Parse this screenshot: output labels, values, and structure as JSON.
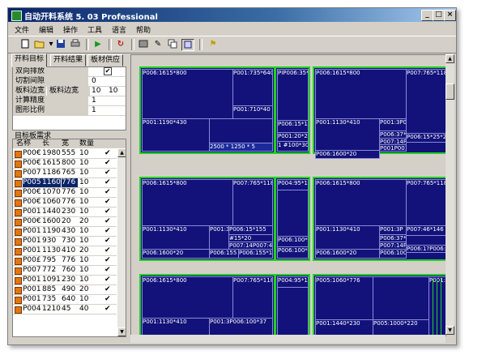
{
  "window": {
    "title": "自动开料系统 5. 03 Professional"
  },
  "titlebar_buttons": [
    "_",
    "□",
    "×"
  ],
  "menu": [
    "文件",
    "编辑",
    "操作",
    "工具",
    "语言",
    "帮助"
  ],
  "toolbar_icons": [
    "new-icon",
    "open-icon",
    "save-icon",
    "print-icon",
    "run-icon",
    "refresh-icon",
    "image-icon",
    "edit-icon",
    "copy-icon",
    "layout-icon",
    "help-icon"
  ],
  "tabs": [
    "开料目标",
    "开料结果",
    "板材供应"
  ],
  "props": [
    {
      "label": "双向排放",
      "value": "✔"
    },
    {
      "label": "切割间隙",
      "value": "0"
    },
    {
      "label": "板料边宽",
      "label2": "板料边宽",
      "value": "10",
      "value2": "10"
    },
    {
      "label": "计算精度",
      "value": "1"
    },
    {
      "label": "图形比例",
      "value": "1"
    }
  ],
  "list_title": "目标板需求",
  "columns": [
    "名称",
    "长",
    "宽",
    "数量"
  ],
  "rows": [
    {
      "name": "P00€",
      "len": "1980",
      "wid": "555",
      "qty": "10",
      "chk": "✔"
    },
    {
      "name": "P00€",
      "len": "1615",
      "wid": "800",
      "qty": "10",
      "chk": "✔"
    },
    {
      "name": "P007",
      "len": "1186",
      "wid": "765",
      "qty": "10",
      "chk": "✔"
    },
    {
      "name": "P005",
      "len": "1160",
      "wid": "776",
      "qty": "10",
      "chk": "✔",
      "selected": true
    },
    {
      "name": "P00€",
      "len": "1070",
      "wid": "776",
      "qty": "10",
      "chk": "✔"
    },
    {
      "name": "P00€",
      "len": "1060",
      "wid": "776",
      "qty": "10",
      "chk": "✔"
    },
    {
      "name": "P001",
      "len": "1440",
      "wid": "230",
      "qty": "10",
      "chk": "✔"
    },
    {
      "name": "P00€",
      "len": "1600",
      "wid": "20",
      "qty": "20",
      "chk": "✔"
    },
    {
      "name": "P001",
      "len": "1190",
      "wid": "430",
      "qty": "10",
      "chk": "✔"
    },
    {
      "name": "P001",
      "len": "930",
      "wid": "730",
      "qty": "10",
      "chk": "✔"
    },
    {
      "name": "P001",
      "len": "1130",
      "wid": "410",
      "qty": "20",
      "chk": "✔"
    },
    {
      "name": "P00£",
      "len": "795",
      "wid": "776",
      "qty": "10",
      "chk": "✔"
    },
    {
      "name": "P007",
      "len": "772",
      "wid": "760",
      "qty": "10",
      "chk": "✔"
    },
    {
      "name": "P001",
      "len": "1091",
      "wid": "230",
      "qty": "10",
      "chk": "✔"
    },
    {
      "name": "P001",
      "len": "885",
      "wid": "490",
      "qty": "20",
      "chk": "✔"
    },
    {
      "name": "P001",
      "len": "735",
      "wid": "640",
      "qty": "10",
      "chk": "✔"
    },
    {
      "name": "P004",
      "len": "1210",
      "wid": "45",
      "qty": "40",
      "chk": "✔"
    }
  ],
  "canvas": {
    "labels": {
      "a1": "P006:1615*800",
      "a2": "P001:735*640",
      "a3": "P001:710*40",
      "a4": "P001:1190*430",
      "a5": "PIP006:35*1",
      "a6": "P006:15*155",
      "a7": "P001:20*2",
      "a8": "2500 * 1250 * 5",
      "a9": "1 #100*30",
      "b1": "P006:1615*800",
      "b2": "P007:765*1186",
      "b3": "P001:1130*410",
      "b4": "P001:3P001:20*250",
      "b5": "P006:37*100",
      "b6": "P007:14P007:46*146",
      "b7": "P006:1600*20",
      "b8": "P001P001",
      "b9": "P006:15*25*25",
      "c1": "P006:1615*800",
      "c2": "P007:765*1186",
      "c3": "P001:1130*410",
      "c4": "P001:3P",
      "c5": "P006:15*155",
      "c6": "P007:14P007:46*146",
      "c7": "P006:1600*20",
      "c8": "P006:155",
      "c9": "#15*20",
      "c10": "P006:155*15",
      "d1": "P004:95*10",
      "d2": "P006:100*",
      "d3": "P006:100*37",
      "e1": "P006:1615*800",
      "e2": "P007:765*1186",
      "e3": "P001:1130*410",
      "e4": "P001:3P",
      "e5": "P007:46*146",
      "e6": "P006:37*100",
      "e7": "P007:14P",
      "e8": "P006:1600*20",
      "e9": "P006:100*37",
      "e10": "P006:1?P006:37*100",
      "f1": "P006:1615*800",
      "f2": "P007:765*1186",
      "f3": "P004:95*10",
      "f4": "P001:1130*410",
      "f5": "P001:3P006:100*37",
      "g1": "P005:1060*776",
      "g2": "P001:60*",
      "g3": "P001:1440*230",
      "g4": "P005:1000*220"
    }
  },
  "colors": {
    "panel": "#12127a",
    "outline": "#22d022",
    "selection": "#0a246a"
  }
}
